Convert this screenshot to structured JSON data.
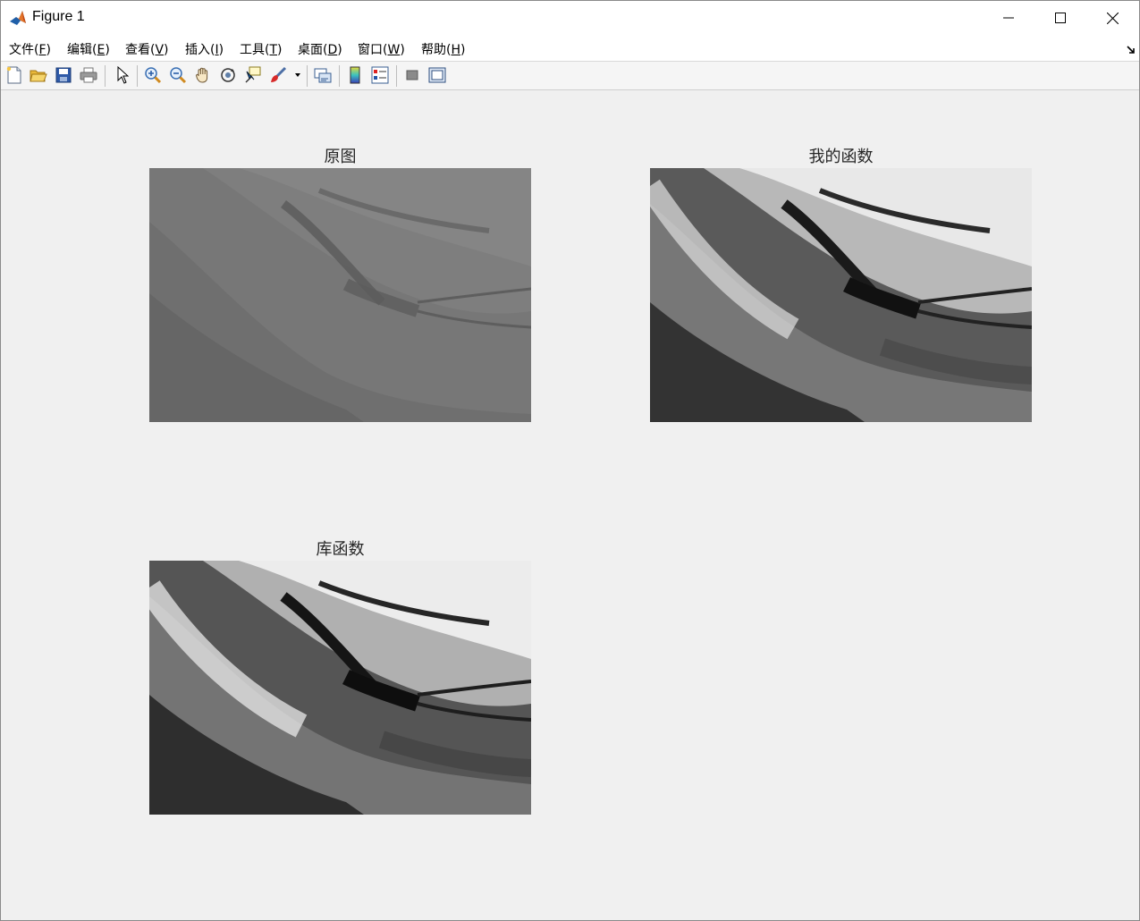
{
  "window": {
    "title": "Figure 1"
  },
  "menu": {
    "items": [
      {
        "label": "文件(",
        "mnemonic": "F",
        "suffix": ")"
      },
      {
        "label": "编辑(",
        "mnemonic": "E",
        "suffix": ")"
      },
      {
        "label": "查看(",
        "mnemonic": "V",
        "suffix": ")"
      },
      {
        "label": "插入(",
        "mnemonic": "I",
        "suffix": ")"
      },
      {
        "label": "工具(",
        "mnemonic": "T",
        "suffix": ")"
      },
      {
        "label": "桌面(",
        "mnemonic": "D",
        "suffix": ")"
      },
      {
        "label": "窗口(",
        "mnemonic": "W",
        "suffix": ")"
      },
      {
        "label": "帮助(",
        "mnemonic": "H",
        "suffix": ")"
      }
    ]
  },
  "toolbar": {
    "icons": [
      "new-figure-icon",
      "open-file-icon",
      "save-icon",
      "print-icon",
      "select-arrow-icon",
      "zoom-in-icon",
      "zoom-out-icon",
      "pan-hand-icon",
      "rotate-3d-icon",
      "data-cursor-icon",
      "brush-icon",
      "link-plot-icon",
      "colorbar-icon",
      "legend-icon",
      "hide-plot-tools-icon",
      "show-plot-tools-icon"
    ]
  },
  "axes": [
    {
      "title": "原图",
      "tone": "original-low-contrast"
    },
    {
      "title": "我的函数",
      "tone": "equalized"
    },
    {
      "title": "库函数",
      "tone": "equalized"
    }
  ]
}
